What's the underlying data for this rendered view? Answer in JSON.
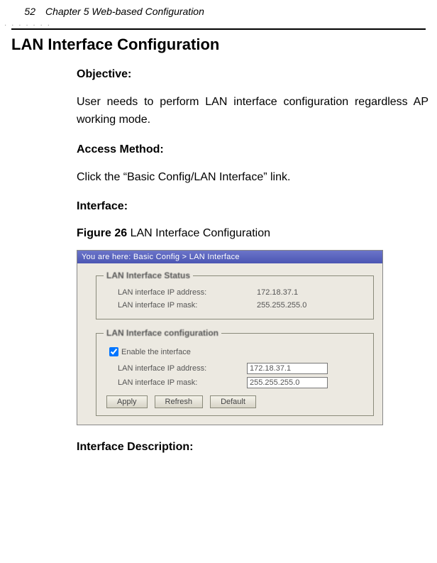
{
  "page": {
    "number": "52",
    "chapter_header": "Chapter 5 Web-based Configuration"
  },
  "section_title": "LAN Interface Configuration",
  "subheads": {
    "objective": "Objective:",
    "access": "Access Method:",
    "interface": "Interface:",
    "interface_desc": "Interface Description:"
  },
  "paragraphs": {
    "objective_text": "User needs to perform LAN interface configuration regardless AP working mode.",
    "access_text": "Click the “Basic Config/LAN Interface” link."
  },
  "figure": {
    "label": "Figure 26",
    "caption": " LAN Interface Configuration"
  },
  "screenshot": {
    "breadcrumb": "You are here:   Basic Config > LAN Interface",
    "status_legend": "LAN Interface Status",
    "config_legend": "LAN Interface configuration",
    "status_rows": [
      {
        "label": "LAN interface IP address:",
        "value": "172.18.37.1"
      },
      {
        "label": "LAN interface IP mask:",
        "value": "255.255.255.0"
      }
    ],
    "enable_label": "Enable the interface",
    "enable_checked": true,
    "config_rows": [
      {
        "label": "LAN interface IP address:",
        "value": "172.18.37.1"
      },
      {
        "label": "LAN interface IP mask:",
        "value": "255.255.255.0"
      }
    ],
    "buttons": {
      "apply": "Apply",
      "refresh": "Refresh",
      "default": "Default"
    }
  }
}
